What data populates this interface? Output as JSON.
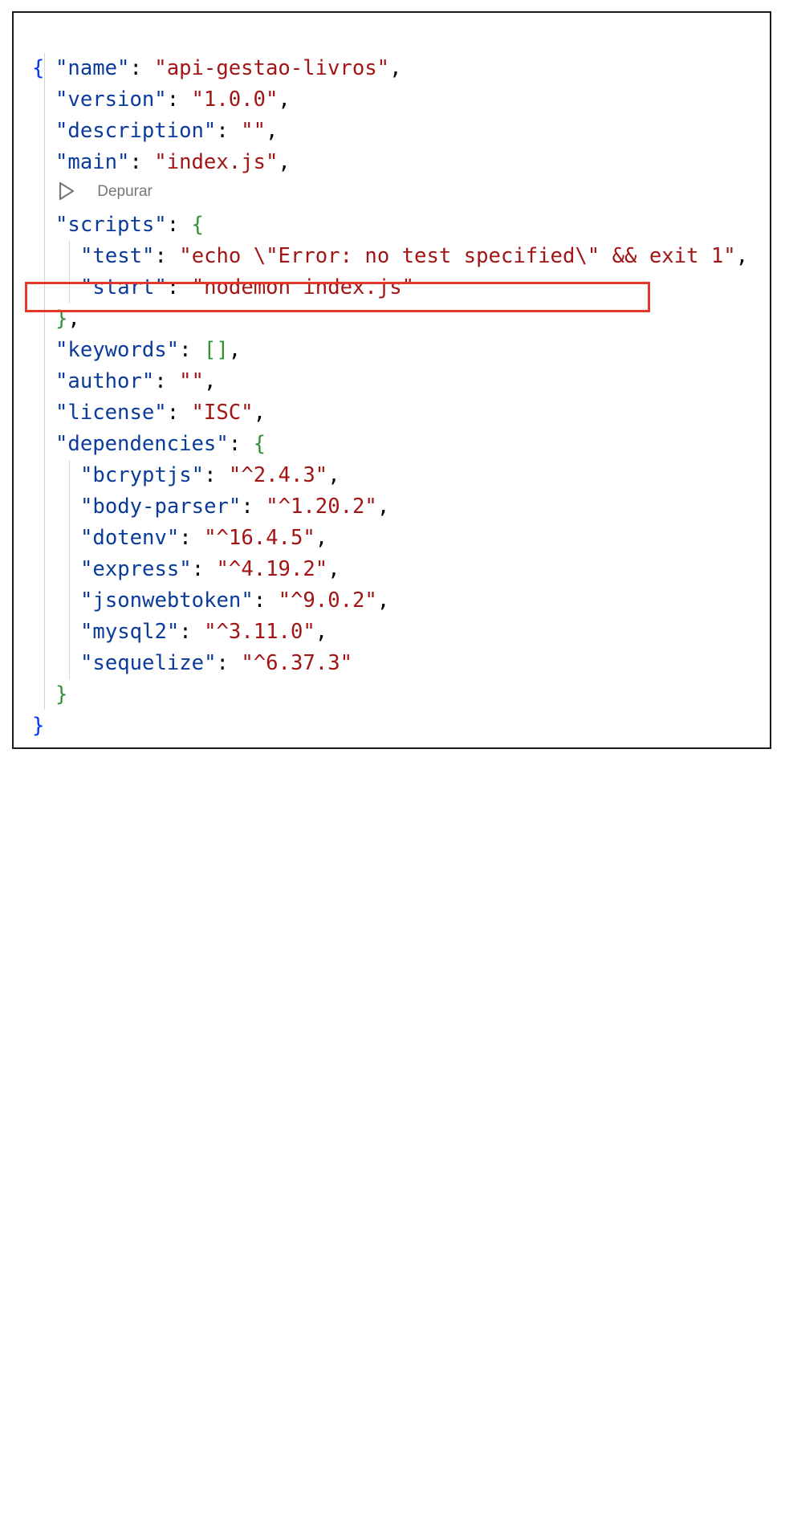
{
  "codelens": {
    "label": "Depurar",
    "icon": "play-outline-icon"
  },
  "colors": {
    "key": "#0a3a9a",
    "string": "#a31515",
    "brace_level1": "#0431fa",
    "brace_level2": "#319331",
    "highlight_border": "#e2372b"
  },
  "code": {
    "open_brace": "{",
    "close_brace": "}",
    "name": {
      "key": "\"name\"",
      "value": "\"api-gestao-livros\""
    },
    "version": {
      "key": "\"version\"",
      "value": "\"1.0.0\""
    },
    "description": {
      "key": "\"description\"",
      "value": "\"\""
    },
    "main": {
      "key": "\"main\"",
      "value": "\"index.js\""
    },
    "scripts": {
      "key": "\"scripts\"",
      "open": "{",
      "close": "}",
      "test": {
        "key": "\"test\"",
        "value": "\"echo \\\"Error: no test specified\\\" && exit 1\""
      },
      "start": {
        "key": "\"start\"",
        "value": "\"nodemon index.js\""
      }
    },
    "keywords": {
      "key": "\"keywords\"",
      "value": "[]"
    },
    "author": {
      "key": "\"author\"",
      "value": "\"\""
    },
    "license": {
      "key": "\"license\"",
      "value": "\"ISC\""
    },
    "dependencies": {
      "key": "\"dependencies\"",
      "open": "{",
      "close": "}",
      "items": [
        {
          "key": "\"bcryptjs\"",
          "value": "\"^2.4.3\""
        },
        {
          "key": "\"body-parser\"",
          "value": "\"^1.20.2\""
        },
        {
          "key": "\"dotenv\"",
          "value": "\"^16.4.5\""
        },
        {
          "key": "\"express\"",
          "value": "\"^4.19.2\""
        },
        {
          "key": "\"jsonwebtoken\"",
          "value": "\"^9.0.2\""
        },
        {
          "key": "\"mysql2\"",
          "value": "\"^3.11.0\""
        },
        {
          "key": "\"sequelize\"",
          "value": "\"^6.37.3\""
        }
      ]
    }
  }
}
